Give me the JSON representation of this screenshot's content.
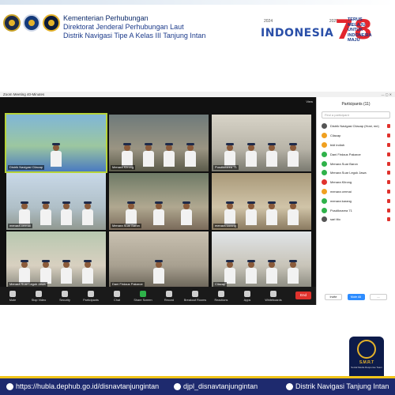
{
  "header": {
    "org_lines": [
      "Kementerian Perhubungan",
      "Direktorat Jenderal Perhubungan Laut",
      "Distrik Navigasi Tipe A Kelas III Tanjung Intan"
    ],
    "indonesia_text": "INDONESIA",
    "indonesia_years": [
      "2024",
      "2029"
    ],
    "anniversary_number": "78",
    "anniversary_slogan": [
      "TERUS",
      "MELAJU",
      "UNTUK",
      "INDONESIA",
      "MAJU"
    ]
  },
  "zoom": {
    "window_title": "Zoom Meeting 40-Minutes",
    "view_label": "View",
    "tiles": [
      {
        "name": "Distrik Navigasi Cilacap",
        "active": true
      },
      {
        "name": "Menara Klirong",
        "active": false
      },
      {
        "name": "Pusdiknarea 71",
        "active": false
      },
      {
        "name": "menara cermai",
        "active": false
      },
      {
        "name": "Menara Suar Baron",
        "active": false
      },
      {
        "name": "menara karang",
        "active": false
      },
      {
        "name": "Menara Suar Legok Jawa",
        "active": false
      },
      {
        "name": "Dani Firdaus Pakaroe",
        "active": false
      },
      {
        "name": "Cilacap",
        "active": false
      }
    ],
    "toolbar": [
      {
        "label": "Mute",
        "icon": "microphone-icon"
      },
      {
        "label": "Stop Video",
        "icon": "video-camera-icon"
      },
      {
        "label": "Security",
        "icon": "shield-icon"
      },
      {
        "label": "Participants",
        "icon": "people-icon"
      },
      {
        "label": "Chat",
        "icon": "chat-icon"
      },
      {
        "label": "Share Screen",
        "icon": "share-screen-icon"
      },
      {
        "label": "Record",
        "icon": "record-icon"
      },
      {
        "label": "Breakout Rooms",
        "icon": "breakout-rooms-icon"
      },
      {
        "label": "Reactions",
        "icon": "smiley-icon"
      },
      {
        "label": "Apps",
        "icon": "apps-icon"
      },
      {
        "label": "Whiteboards",
        "icon": "whiteboard-icon"
      }
    ],
    "end_label": "End",
    "participants": {
      "title": "Participants (11)",
      "search_placeholder": "Find a participant",
      "list": [
        {
          "name": "Distrik Navigasi Cilacap (Host, me)",
          "color": "#555555"
        },
        {
          "name": "Cilacap",
          "color": "#f0a020"
        },
        {
          "name": "bidi indiah",
          "color": "#f0a020"
        },
        {
          "name": "Dani Firdaus Pakaroe",
          "color": "#2fb24a"
        },
        {
          "name": "Menara Suar Baron",
          "color": "#2fb24a"
        },
        {
          "name": "Menara Suar Legok Jawa",
          "color": "#2fb24a"
        },
        {
          "name": "Menara Klirong",
          "color": "#e0322d"
        },
        {
          "name": "menara cermai",
          "color": "#f0a020"
        },
        {
          "name": "menara karang",
          "color": "#2fb24a"
        },
        {
          "name": "Pusdiknarea 71",
          "color": "#2fb24a"
        },
        {
          "name": "sari tito",
          "color": "#555555"
        }
      ],
      "invite_label": "Invite",
      "mute_all_label": "Mute All",
      "more_label": "..."
    }
  },
  "footer": {
    "url": "https://hubla.dephub.go.id/disnavtanjungintan",
    "social": "djpl_disnavtanjungintan",
    "youtube": "Distrik Navigasi Tanjung Intan",
    "badge_title": "S.M.R.T",
    "badge_sub": "Social Media Response Team"
  }
}
